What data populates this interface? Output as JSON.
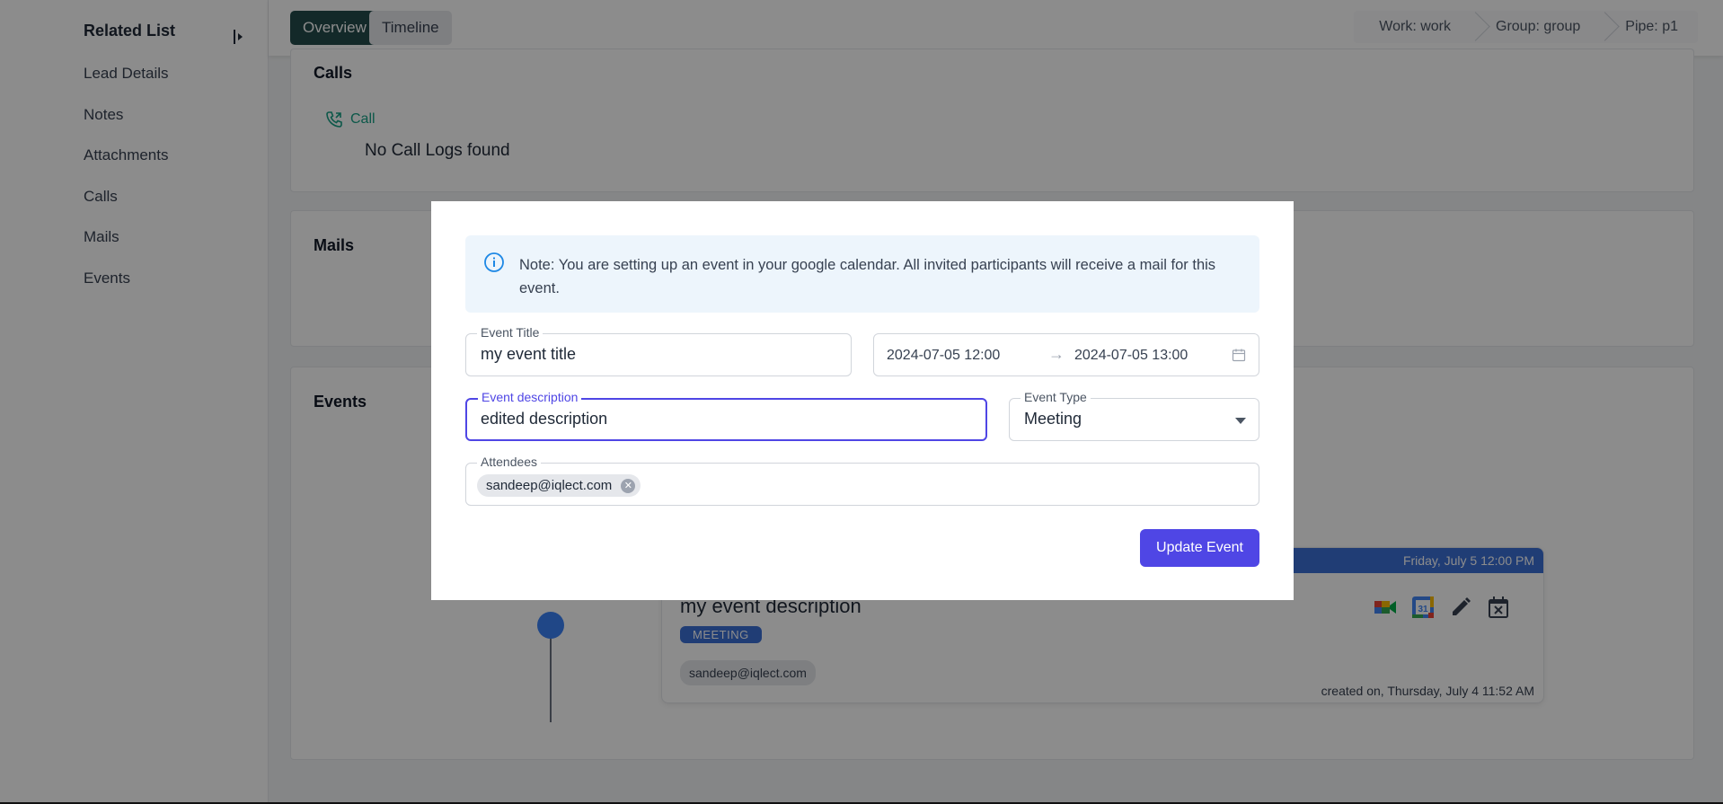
{
  "sidebar": {
    "title": "Related List",
    "items": [
      {
        "label": "Lead Details"
      },
      {
        "label": "Notes"
      },
      {
        "label": "Attachments"
      },
      {
        "label": "Calls"
      },
      {
        "label": "Mails"
      },
      {
        "label": "Events"
      }
    ]
  },
  "topbar": {
    "tabs": [
      {
        "label": "Overview",
        "active": true
      },
      {
        "label": "Timeline",
        "active": false
      }
    ],
    "breadcrumbs": [
      "Work: work",
      "Group: group",
      "Pipe: p1"
    ]
  },
  "calls_section": {
    "title": "Calls",
    "call_link": "Call",
    "empty_text": "No Call Logs found"
  },
  "mails_section": {
    "title": "Mails"
  },
  "events_section": {
    "title": "Events",
    "event": {
      "header_date": "Friday, July 5 12:00 PM",
      "description": "my event description",
      "type_badge": "MEETING",
      "attendee": "sandeep@iqlect.com",
      "created": "created on, Thursday, July 4 11:52 AM",
      "icons": [
        "google-meet-icon",
        "google-calendar-icon",
        "edit-icon",
        "delete-event-icon"
      ]
    }
  },
  "modal": {
    "note": "Note: You are setting up an event in your google calendar. All invited participants will receive a mail for this event.",
    "event_title": {
      "label": "Event Title",
      "value": "my event title"
    },
    "date_range": {
      "start": "2024-07-05 12:00",
      "separator": "→",
      "end": "2024-07-05 13:00"
    },
    "event_description": {
      "label": "Event description",
      "value": "edited description"
    },
    "event_type": {
      "label": "Event Type",
      "value": "Meeting"
    },
    "attendees": {
      "label": "Attendees",
      "chips": [
        "sandeep@iqlect.com"
      ]
    },
    "submit_label": "Update Event"
  },
  "colors": {
    "primary": "#4f46e5",
    "tab_active": "#234b4b",
    "event_blue": "#3b6fd6",
    "call_green": "#16a085",
    "note_bg": "#edf5fc"
  }
}
